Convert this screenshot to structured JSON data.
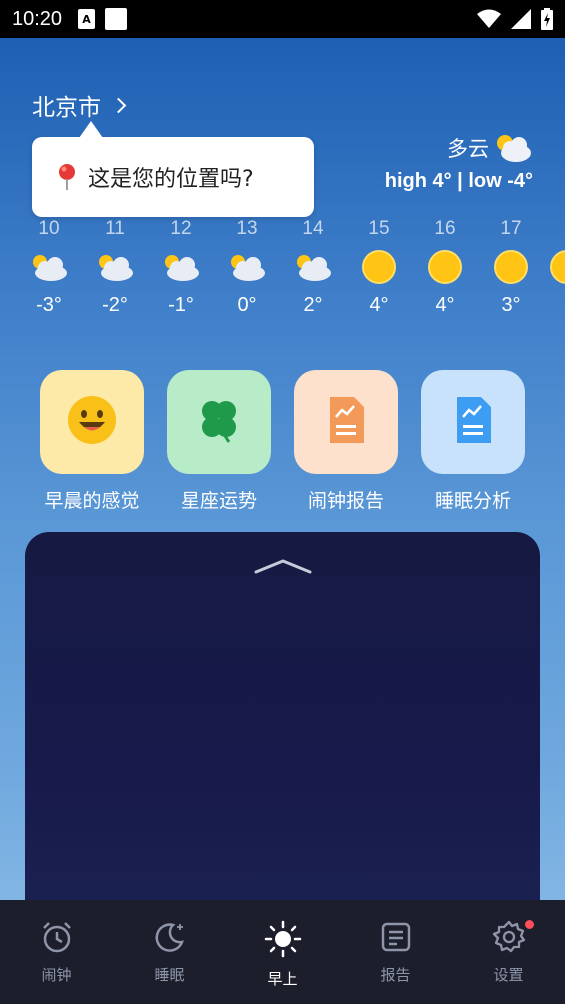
{
  "status_bar": {
    "time": "10:20",
    "notice_glyph": "A"
  },
  "location": {
    "city": "北京市",
    "prompt": "这是您的位置吗?"
  },
  "current": {
    "condition": "多云",
    "hi_lo": "high 4° | low -4°"
  },
  "forecast": [
    {
      "hour": "10",
      "icon": "partly-cloudy-icon",
      "temp": "-3°"
    },
    {
      "hour": "11",
      "icon": "partly-cloudy-icon",
      "temp": "-2°"
    },
    {
      "hour": "12",
      "icon": "partly-cloudy-icon",
      "temp": "-1°"
    },
    {
      "hour": "13",
      "icon": "partly-cloudy-icon",
      "temp": "0°"
    },
    {
      "hour": "14",
      "icon": "partly-cloudy-icon",
      "temp": "2°"
    },
    {
      "hour": "15",
      "icon": "sun-icon",
      "temp": "4°"
    },
    {
      "hour": "16",
      "icon": "sun-icon",
      "temp": "4°"
    },
    {
      "hour": "17",
      "icon": "sun-icon",
      "temp": "3°"
    }
  ],
  "features": [
    {
      "label": "早晨的感觉",
      "icon": "smiley-icon",
      "bg": "#fde9a8"
    },
    {
      "label": "星座运势",
      "icon": "clover-icon",
      "bg": "#b8ecc8"
    },
    {
      "label": "闹钟报告",
      "icon": "report-icon",
      "bg": "#fde1cc"
    },
    {
      "label": "睡眠分析",
      "icon": "analysis-icon",
      "bg": "#c9e2fb"
    }
  ],
  "tabs": [
    {
      "label": "闹钟",
      "icon": "alarm-clock-icon",
      "active": false
    },
    {
      "label": "睡眠",
      "icon": "moon-icon",
      "active": false
    },
    {
      "label": "早上",
      "icon": "sun-icon",
      "active": true
    },
    {
      "label": "报告",
      "icon": "report-icon",
      "active": false
    },
    {
      "label": "设置",
      "icon": "gear-icon",
      "active": false,
      "badge": true
    }
  ],
  "colors": {
    "accent_sun": "#ffc414",
    "badge": "#ff4d5a",
    "tab_bar": "#1c1e2b",
    "panel": "#161a42"
  }
}
